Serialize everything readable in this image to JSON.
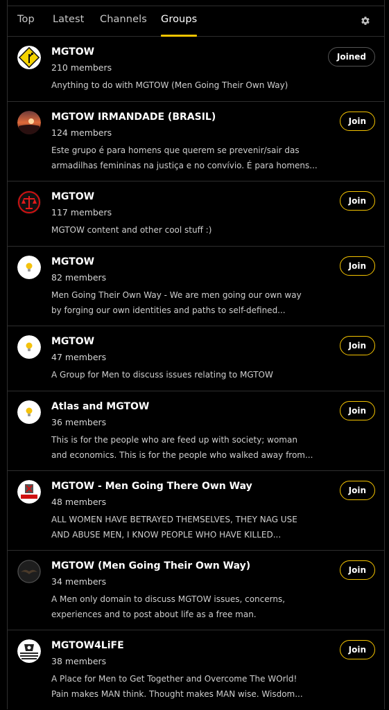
{
  "tabs": [
    {
      "label": "Top",
      "active": false
    },
    {
      "label": "Latest",
      "active": false
    },
    {
      "label": "Channels",
      "active": false
    },
    {
      "label": "Groups",
      "active": true
    }
  ],
  "colors": {
    "accent": "#f5c400",
    "background": "#000000",
    "divider": "#2e2e2e"
  },
  "settings_icon": "gear-icon",
  "groups": [
    {
      "name": "MGTOW",
      "members": "210 members",
      "desc": [
        "Anything to do with MGTOW (Men Going Their Own Way)"
      ],
      "button": "Joined",
      "avatar": "yellow-diamond-road-sign"
    },
    {
      "name": "MGTOW IRMANDADE (BRASIL)",
      "members": "124 members",
      "desc": [
        "Este grupo é para homens que querem se prevenir/sair das",
        "armadilhas femininas na justiça e no convívio. É para homens..."
      ],
      "button": "Join",
      "avatar": "sunset-photo"
    },
    {
      "name": "MGTOW",
      "members": "117 members",
      "desc": [
        "MGTOW content and other cool stuff :)"
      ],
      "button": "Join",
      "avatar": "red-scales-of-justice"
    },
    {
      "name": "MGTOW",
      "members": "82 members",
      "desc": [
        "Men Going Their Own Way - We are men going our own way",
        "by forging our own identities and paths to self-defined..."
      ],
      "button": "Join",
      "avatar": "lightbulb-icon"
    },
    {
      "name": "MGTOW",
      "members": "47 members",
      "desc": [
        "A Group for Men to discuss issues relating to MGTOW"
      ],
      "button": "Join",
      "avatar": "lightbulb-icon"
    },
    {
      "name": "Atlas and MGTOW",
      "members": "36 members",
      "desc": [
        "This is for the people who are feed up with society; woman",
        "and economics. This is for the people who walked away from..."
      ],
      "button": "Join",
      "avatar": "lightbulb-icon"
    },
    {
      "name": "MGTOW - Men Going There Own Way",
      "members": "48 members",
      "desc": [
        "ALL WOMEN HAVE BETRAYED THEMSELVES, THEY NAG USE",
        "AND ABUSE MEN, I KNOW PEOPLE WHO HAVE KILLED..."
      ],
      "button": "Join",
      "avatar": "mgtow-red-badge"
    },
    {
      "name": "MGTOW (Men Going Their Own Way)",
      "members": "34 members",
      "desc": [
        "A Men only domain to discuss MGTOW issues, concerns,",
        "experiences and to post about life as a free man."
      ],
      "button": "Join",
      "avatar": "dark-eagle-photo"
    },
    {
      "name": "MGTOW4LiFE",
      "members": "38 members",
      "desc": [
        "A Place for Men to Get Together and Overcome The WOrld!",
        "Pain makes MAN think. Thought makes MAN wise. Wisdom..."
      ],
      "button": "Join",
      "avatar": "flag-emblem"
    }
  ]
}
